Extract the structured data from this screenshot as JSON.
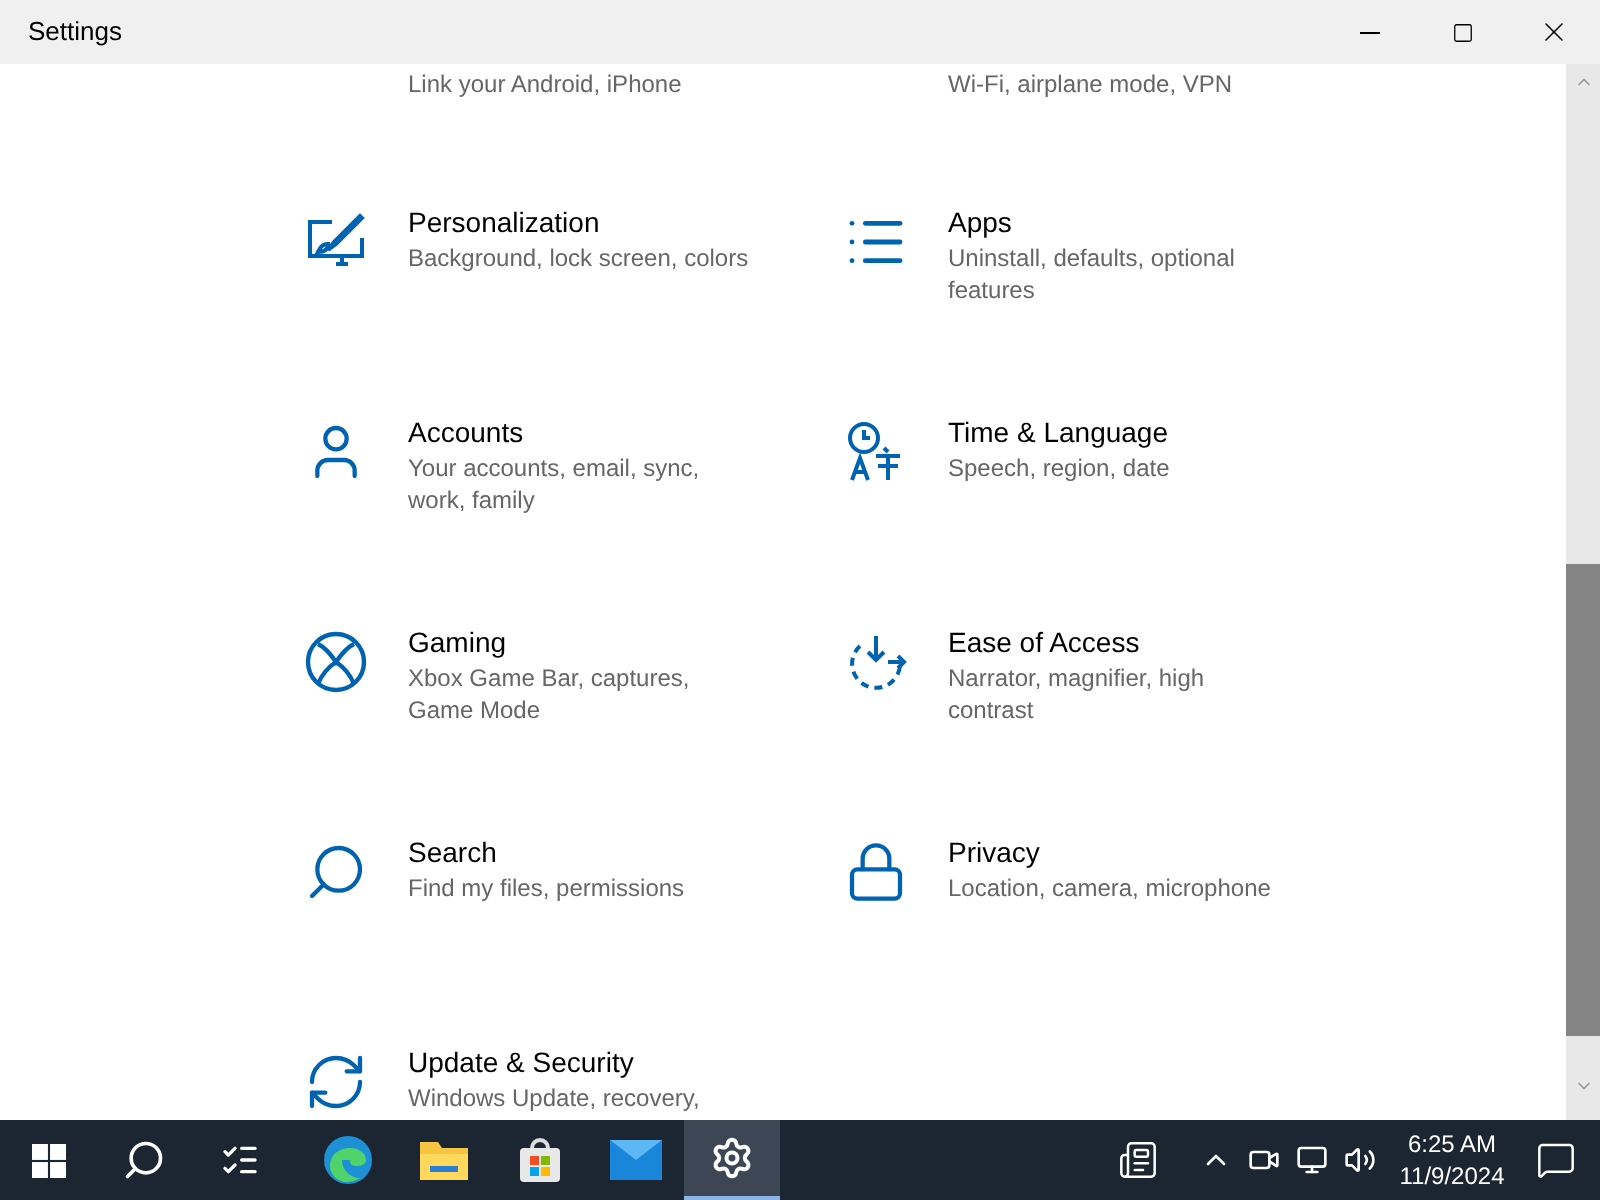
{
  "window": {
    "title": "Settings"
  },
  "cut_off_descriptions": [
    "Link your Android, iPhone",
    "Wi-Fi, airplane mode, VPN"
  ],
  "settings": [
    {
      "kind": "personalization",
      "title": "Personalization",
      "description": "Background, lock screen, colors"
    },
    {
      "kind": "apps",
      "title": "Apps",
      "description": "Uninstall, defaults, optional features"
    },
    {
      "kind": "accounts",
      "title": "Accounts",
      "description": "Your accounts, email, sync, work, family"
    },
    {
      "kind": "time",
      "title": "Time & Language",
      "description": "Speech, region, date"
    },
    {
      "kind": "gaming",
      "title": "Gaming",
      "description": "Xbox Game Bar, captures, Game Mode"
    },
    {
      "kind": "ease",
      "title": "Ease of Access",
      "description": "Narrator, magnifier, high contrast"
    },
    {
      "kind": "search",
      "title": "Search",
      "description": "Find my files, permissions"
    },
    {
      "kind": "privacy",
      "title": "Privacy",
      "description": "Location, camera, microphone"
    },
    {
      "kind": "update",
      "title": "Update & Security",
      "description": "Windows Update, recovery,"
    }
  ],
  "taskbar": {
    "apps": [
      {
        "kind": "start",
        "selected": false
      },
      {
        "kind": "search",
        "selected": false
      },
      {
        "kind": "taskview",
        "selected": false
      },
      {
        "kind": "browser",
        "selected": false
      },
      {
        "kind": "folder",
        "selected": false
      },
      {
        "kind": "store",
        "selected": false
      },
      {
        "kind": "mail",
        "selected": false
      },
      {
        "kind": "settings",
        "selected": true
      }
    ],
    "time": "6:25 AM",
    "date": "11/9/2024"
  }
}
